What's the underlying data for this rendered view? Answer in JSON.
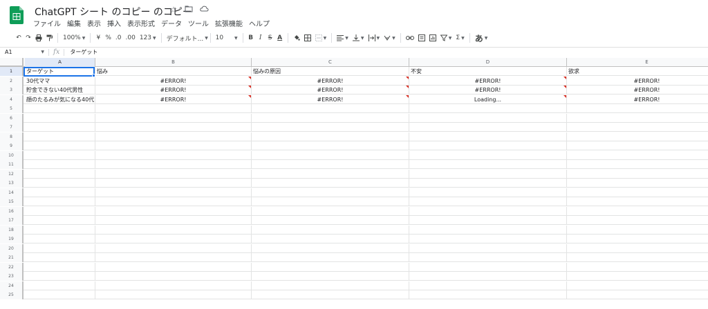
{
  "document": {
    "title": "ChatGPT シート のコピー のコピー",
    "title_icons": [
      "star-icon",
      "move-folder-icon",
      "cloud-status-icon"
    ]
  },
  "menu": {
    "items": [
      "ファイル",
      "編集",
      "表示",
      "挿入",
      "表示形式",
      "データ",
      "ツール",
      "拡張機能",
      "ヘルプ"
    ]
  },
  "toolbar": {
    "zoom": "100%",
    "currency": "¥",
    "percent": "%",
    "decimal_decrease": ".0",
    "decimal_increase": ".00",
    "more_formats": "123",
    "font": "デフォルト...",
    "font_size": "10",
    "bold": "B",
    "italic": "I",
    "strike": "S",
    "text_color": "A",
    "input_tools": "あ"
  },
  "formula_bar": {
    "name_box": "A1",
    "fx": "fx",
    "value": "ターゲット"
  },
  "columns": [
    "A",
    "B",
    "C",
    "D",
    "E"
  ],
  "rows": [
    {
      "num": "1",
      "cells": [
        "ターゲット",
        "悩み",
        "悩みの原因",
        "不安",
        "欲求"
      ]
    },
    {
      "num": "2",
      "cells": [
        "30代ママ",
        "#ERROR!",
        "#ERROR!",
        "#ERROR!",
        "#ERROR!"
      ]
    },
    {
      "num": "3",
      "cells": [
        "貯金できない40代男性",
        "#ERROR!",
        "#ERROR!",
        "#ERROR!",
        "#ERROR!"
      ]
    },
    {
      "num": "4",
      "cells": [
        "顔のたるみが気になる40代",
        "#ERROR!",
        "#ERROR!",
        "Loading...",
        "#ERROR!"
      ]
    },
    {
      "num": "5",
      "cells": [
        "",
        "",
        "",
        "",
        ""
      ]
    },
    {
      "num": "6",
      "cells": [
        "",
        "",
        "",
        "",
        ""
      ]
    },
    {
      "num": "7",
      "cells": [
        "",
        "",
        "",
        "",
        ""
      ]
    },
    {
      "num": "8",
      "cells": [
        "",
        "",
        "",
        "",
        ""
      ]
    },
    {
      "num": "9",
      "cells": [
        "",
        "",
        "",
        "",
        ""
      ]
    },
    {
      "num": "10",
      "cells": [
        "",
        "",
        "",
        "",
        ""
      ]
    },
    {
      "num": "11",
      "cells": [
        "",
        "",
        "",
        "",
        ""
      ]
    },
    {
      "num": "12",
      "cells": [
        "",
        "",
        "",
        "",
        ""
      ]
    },
    {
      "num": "13",
      "cells": [
        "",
        "",
        "",
        "",
        ""
      ]
    },
    {
      "num": "14",
      "cells": [
        "",
        "",
        "",
        "",
        ""
      ]
    },
    {
      "num": "15",
      "cells": [
        "",
        "",
        "",
        "",
        ""
      ]
    },
    {
      "num": "16",
      "cells": [
        "",
        "",
        "",
        "",
        ""
      ]
    },
    {
      "num": "17",
      "cells": [
        "",
        "",
        "",
        "",
        ""
      ]
    },
    {
      "num": "18",
      "cells": [
        "",
        "",
        "",
        "",
        ""
      ]
    },
    {
      "num": "19",
      "cells": [
        "",
        "",
        "",
        "",
        ""
      ]
    },
    {
      "num": "20",
      "cells": [
        "",
        "",
        "",
        "",
        ""
      ]
    },
    {
      "num": "21",
      "cells": [
        "",
        "",
        "",
        "",
        ""
      ]
    },
    {
      "num": "22",
      "cells": [
        "",
        "",
        "",
        "",
        ""
      ]
    },
    {
      "num": "23",
      "cells": [
        "",
        "",
        "",
        "",
        ""
      ]
    },
    {
      "num": "24",
      "cells": [
        "",
        "",
        "",
        "",
        ""
      ]
    },
    {
      "num": "25",
      "cells": [
        "",
        "",
        "",
        "",
        ""
      ]
    }
  ],
  "colors": {
    "selection": "#1a73e8",
    "error_flag": "#d93025",
    "brand_green": "#0f9d58"
  }
}
